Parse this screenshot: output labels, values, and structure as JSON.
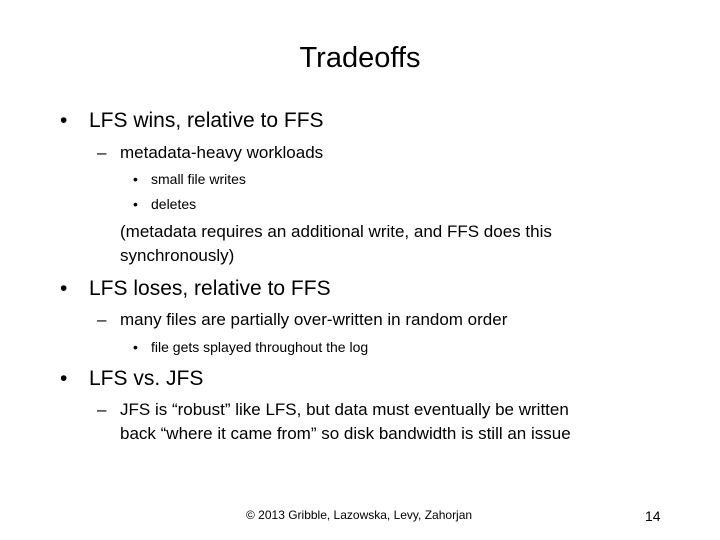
{
  "slide": {
    "title": "Tradeoffs",
    "bullet_marker": "•",
    "dash_marker": "–",
    "small_bullet_marker": "•",
    "sections": [
      {
        "heading": "LFS wins, relative to FFS",
        "sub": "metadata-heavy workloads",
        "items": [
          "small file writes",
          "deletes"
        ],
        "note_line1": "(metadata requires an additional write, and FFS does this",
        "note_line2": "synchronously)"
      },
      {
        "heading": "LFS loses, relative to FFS",
        "sub": "many files are partially over-written in random order",
        "items": [
          "file gets splayed throughout the log"
        ]
      },
      {
        "heading": "LFS vs. JFS",
        "sub_line1": "JFS is “robust” like LFS, but data must eventually be written",
        "sub_line2": "back “where it came from” so disk bandwidth is still an issue"
      }
    ],
    "footer": "© 2013 Gribble, Lazowska, Levy, Zahorjan",
    "page_number": "14"
  }
}
